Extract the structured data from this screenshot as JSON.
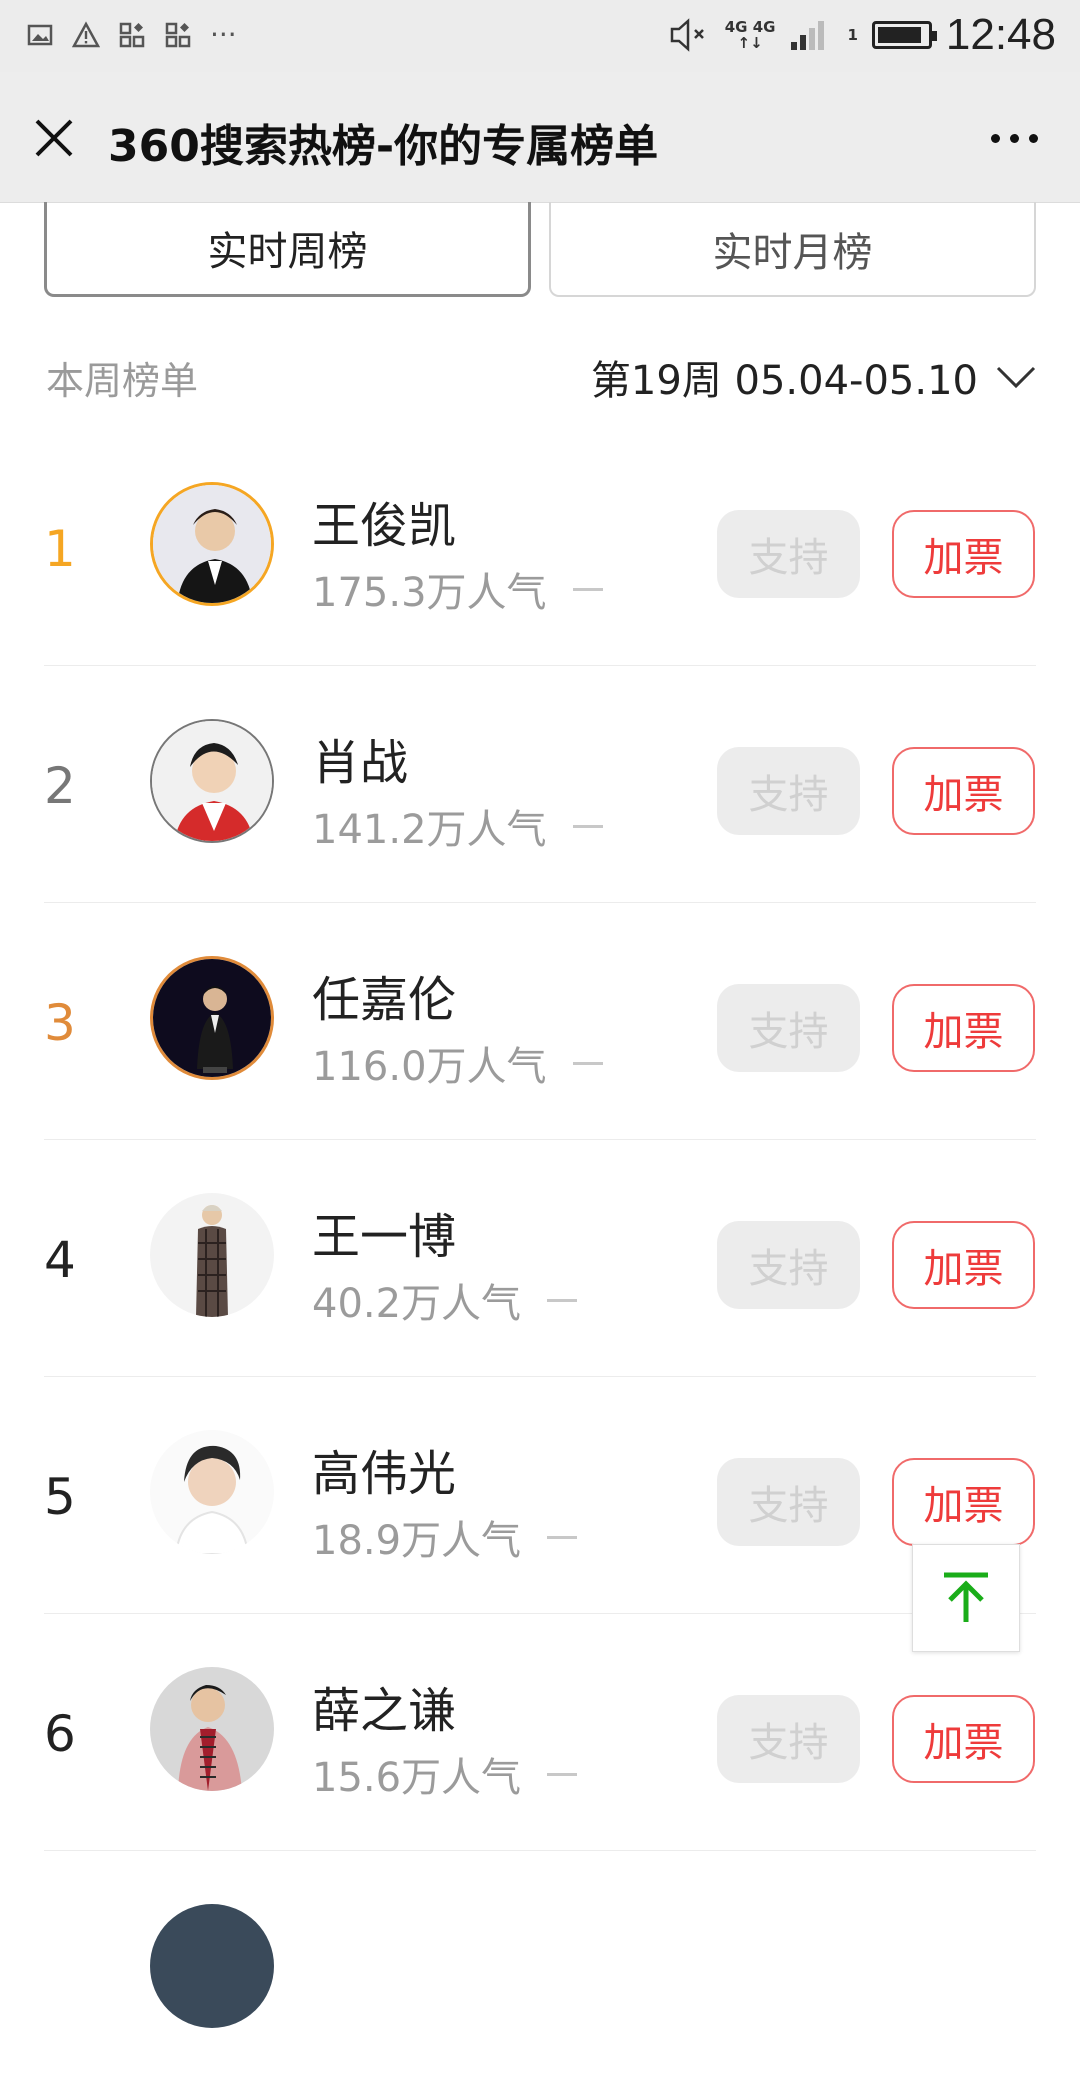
{
  "status_bar": {
    "time": "12:48",
    "network_top": "4G 4G",
    "network_sub": "1",
    "battery_level": 0.9
  },
  "nav": {
    "title": "360搜索热榜-你的专属榜单"
  },
  "tabs": [
    {
      "label": "实时周榜",
      "active": true
    },
    {
      "label": "实时月榜",
      "active": false
    }
  ],
  "week": {
    "label": "本周榜单",
    "selected": "第19周 05.04-05.10"
  },
  "colors": {
    "gold": "#f5a623",
    "bronze": "#e08b3a",
    "vote_red": "#ee3b3b",
    "top_arrow": "#1aad19"
  },
  "list": [
    {
      "rank": "1",
      "name": "王俊凯",
      "popularity": "175.3万人气",
      "support_label": "支持",
      "vote_label": "加票"
    },
    {
      "rank": "2",
      "name": "肖战",
      "popularity": "141.2万人气",
      "support_label": "支持",
      "vote_label": "加票"
    },
    {
      "rank": "3",
      "name": "任嘉伦",
      "popularity": "116.0万人气",
      "support_label": "支持",
      "vote_label": "加票"
    },
    {
      "rank": "4",
      "name": "王一博",
      "popularity": "40.2万人气",
      "support_label": "支持",
      "vote_label": "加票"
    },
    {
      "rank": "5",
      "name": "高伟光",
      "popularity": "18.9万人气",
      "support_label": "支持",
      "vote_label": "加票"
    },
    {
      "rank": "6",
      "name": "薛之谦",
      "popularity": "15.6万人气",
      "support_label": "支持",
      "vote_label": "加票"
    }
  ]
}
